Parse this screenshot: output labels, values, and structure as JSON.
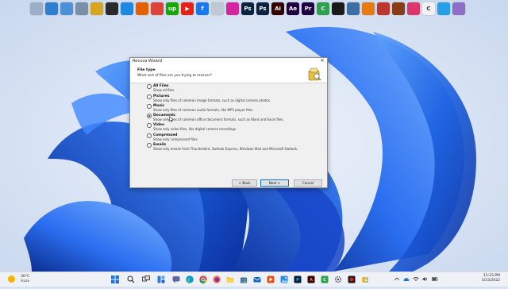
{
  "desktop_icons": [
    {
      "name": "recycle-bin-icon",
      "color": "#9bb0c8",
      "label": ""
    },
    {
      "name": "this-pc-icon",
      "color": "#2f7fd0",
      "label": ""
    },
    {
      "name": "network-icon",
      "color": "#4f8fd8",
      "label": ""
    },
    {
      "name": "tools-icon",
      "color": "#7a8fa8",
      "label": ""
    },
    {
      "name": "folder-icon",
      "color": "#d8a520",
      "label": ""
    },
    {
      "name": "app-icon",
      "color": "#2a2a2a",
      "label": ""
    },
    {
      "name": "browser-icon",
      "color": "#1e88e5",
      "label": ""
    },
    {
      "name": "firefox-icon",
      "color": "#e66000",
      "label": ""
    },
    {
      "name": "chrome-icon",
      "color": "#db4437",
      "label": ""
    },
    {
      "name": "upwork-icon",
      "color": "#14a800",
      "label": "up"
    },
    {
      "name": "youtube-icon",
      "color": "#e62117",
      "label": "▶"
    },
    {
      "name": "facebook-icon",
      "color": "#1877f2",
      "label": "f"
    },
    {
      "name": "media-icon",
      "color": "#c0c8d4",
      "label": ""
    },
    {
      "name": "instagram-icon",
      "color": "#d6249f",
      "label": ""
    },
    {
      "name": "photoshop-icon",
      "color": "#0b2440",
      "label": "Ps"
    },
    {
      "name": "photoshop-alt-icon",
      "color": "#0b2440",
      "label": "Ps"
    },
    {
      "name": "illustrator-icon",
      "color": "#330000",
      "label": "Ai"
    },
    {
      "name": "after-effects-icon",
      "color": "#1f0040",
      "label": "Ae"
    },
    {
      "name": "premiere-icon",
      "color": "#1f0040",
      "label": "Pr"
    },
    {
      "name": "camtasia-icon",
      "color": "#2aa14a",
      "label": "C"
    },
    {
      "name": "dark-app-icon",
      "color": "#1a1a1a",
      "label": ""
    },
    {
      "name": "tool-icon",
      "color": "#3a6ea5",
      "label": ""
    },
    {
      "name": "orange-app-icon",
      "color": "#e87a10",
      "label": ""
    },
    {
      "name": "red-app-icon",
      "color": "#c0352b",
      "label": ""
    },
    {
      "name": "game-icon",
      "color": "#8a3d14",
      "label": ""
    },
    {
      "name": "pink-app-icon",
      "color": "#e0356a",
      "label": ""
    },
    {
      "name": "white-app-icon",
      "color": "#f2f2f2",
      "label": "C"
    },
    {
      "name": "vscode-icon",
      "color": "#23a0e8",
      "label": ""
    },
    {
      "name": "purple-app-icon",
      "color": "#8d6fc7",
      "label": ""
    }
  ],
  "dialog": {
    "title": "Recuva Wizard",
    "close": "✕",
    "header_title": "File type",
    "header_subtitle": "What sort of files are you trying to recover?",
    "options": [
      {
        "label": "All Files",
        "desc": "Show all files.",
        "selected": false
      },
      {
        "label": "Pictures",
        "desc": "Show only files of common image formats, such as digital camera photos.",
        "selected": false
      },
      {
        "label": "Music",
        "desc": "Show only files of common audio formats, like MP3 player files.",
        "selected": false
      },
      {
        "label": "Documents",
        "desc": "Show only files of common office document formats, such as Word and Excel files.",
        "selected": true
      },
      {
        "label": "Video",
        "desc": "Show only video files, like digital camera recordings.",
        "selected": false
      },
      {
        "label": "Compressed",
        "desc": "Show only compressed files.",
        "selected": false
      },
      {
        "label": "Emails",
        "desc": "Show only emails from Thunderbird, Outlook Express, Windows Mail and Microsoft Outlook.",
        "selected": false
      }
    ],
    "back_label": "< Back",
    "next_label": "Next >",
    "cancel_label": "Cancel"
  },
  "taskbar": {
    "weather_temp": "30°C",
    "weather_cond": "Haze",
    "time": "11:23 PM",
    "date": "5/23/2022"
  },
  "colors": {
    "wallpaper_blue": "#1a5cd8",
    "accent": "#0078d7"
  }
}
